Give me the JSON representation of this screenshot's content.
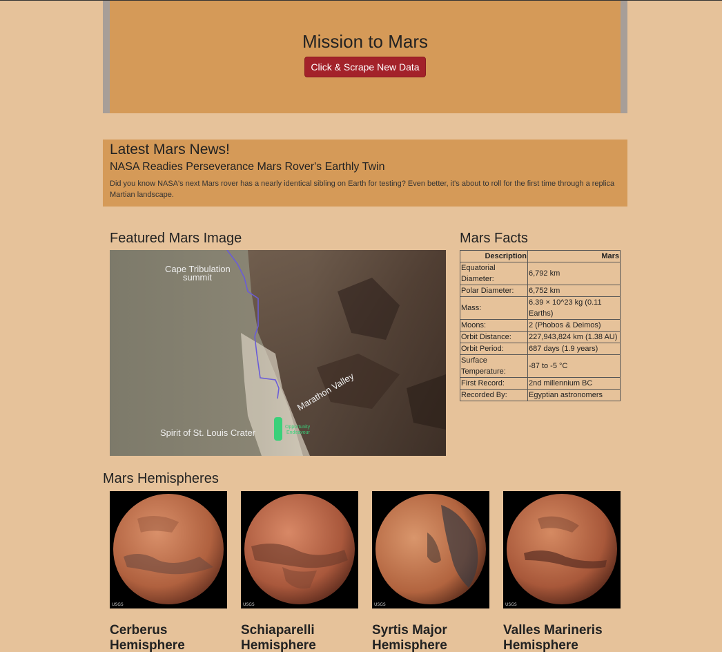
{
  "header": {
    "title": "Mission to Mars",
    "scrape_button": "Click & Scrape New Data"
  },
  "news": {
    "section_title": "Latest Mars News!",
    "headline": "NASA Readies Perseverance Mars Rover's Earthly Twin",
    "teaser": "Did you know NASA's next Mars rover has a nearly identical sibling on Earth for testing? Even better, it's about to roll for the first time through a replica Martian landscape."
  },
  "featured": {
    "section_title": "Featured Mars Image",
    "labels": {
      "cape": "Cape Tribulation",
      "cape2": "summit",
      "valley": "Marathon Valley",
      "crater": "Spirit of St. Louis Crater",
      "rover": "Opportunity",
      "rover2": "Endeavour"
    }
  },
  "facts": {
    "section_title": "Mars Facts",
    "headers": [
      "Description",
      "Mars"
    ],
    "rows": [
      {
        "desc": "Equatorial Diameter:",
        "val": "6,792 km"
      },
      {
        "desc": "Polar Diameter:",
        "val": "6,752 km"
      },
      {
        "desc": "Mass:",
        "val": "6.39 × 10^23 kg (0.11 Earths)"
      },
      {
        "desc": "Moons:",
        "val": "2 (Phobos & Deimos)"
      },
      {
        "desc": "Orbit Distance:",
        "val": "227,943,824 km (1.38 AU)"
      },
      {
        "desc": "Orbit Period:",
        "val": "687 days (1.9 years)"
      },
      {
        "desc": "Surface Temperature:",
        "val": "-87 to -5 °C"
      },
      {
        "desc": "First Record:",
        "val": "2nd millennium BC"
      },
      {
        "desc": "Recorded By:",
        "val": "Egyptian astronomers"
      }
    ]
  },
  "hemispheres": {
    "section_title": "Mars Hemispheres",
    "items": [
      {
        "title": "Cerberus Hemisphere",
        "logo": "USGS"
      },
      {
        "title": "Schiaparelli Hemisphere",
        "logo": "USGS"
      },
      {
        "title": "Syrtis Major Hemisphere",
        "logo": "USGS"
      },
      {
        "title": "Valles Marineris Hemisphere",
        "logo": "USGS"
      }
    ]
  }
}
